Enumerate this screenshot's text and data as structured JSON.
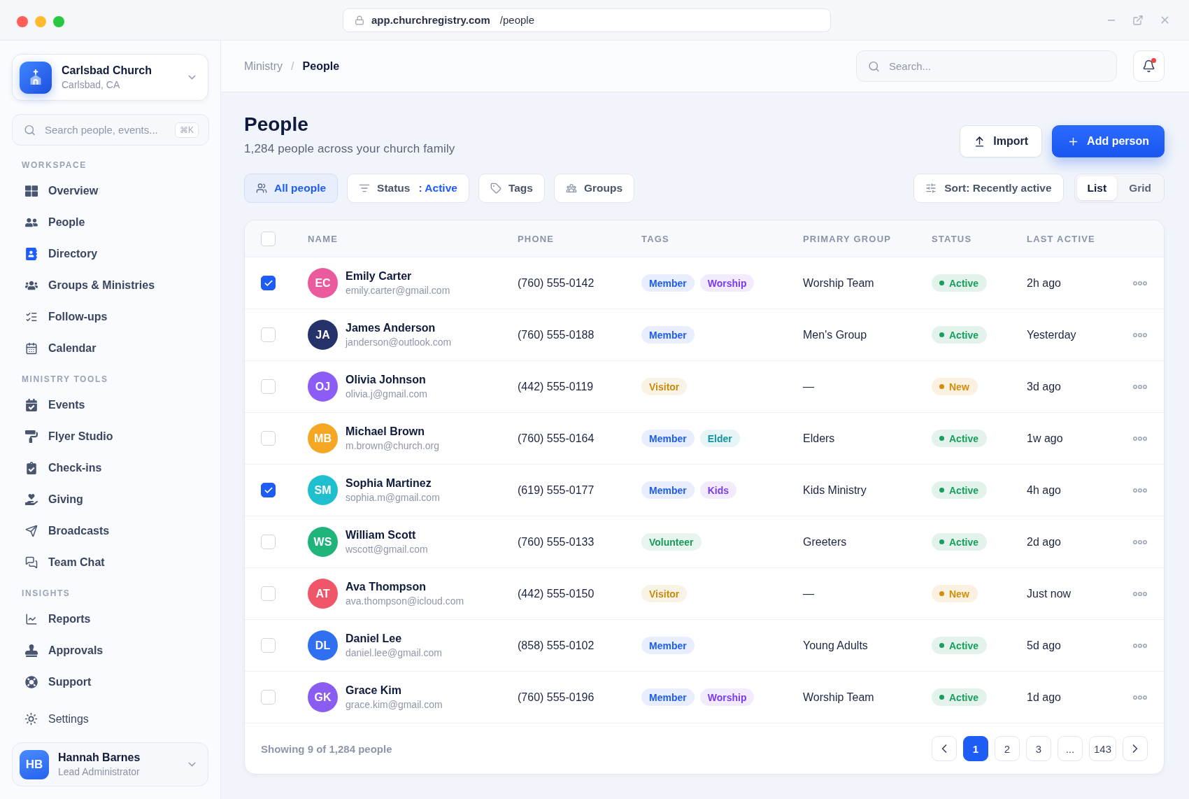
{
  "window": {
    "url_host": "app.churchregistry.com",
    "url_path": "/people"
  },
  "sidebar": {
    "church": {
      "name": "Carlsbad Church",
      "location": "Carlsbad, CA"
    },
    "search": {
      "placeholder": "Search people, events...",
      "shortcut": "⌘K"
    },
    "sections": [
      {
        "title": "WORKSPACE",
        "items": [
          {
            "label": "Overview"
          },
          {
            "label": "People"
          },
          {
            "label": "Directory"
          },
          {
            "label": "Groups & Ministries"
          },
          {
            "label": "Follow-ups"
          },
          {
            "label": "Calendar"
          }
        ]
      },
      {
        "title": "MINISTRY TOOLS",
        "items": [
          {
            "label": "Events"
          },
          {
            "label": "Flyer Studio"
          },
          {
            "label": "Check-ins"
          },
          {
            "label": "Giving"
          },
          {
            "label": "Broadcasts"
          },
          {
            "label": "Team Chat"
          }
        ]
      },
      {
        "title": "INSIGHTS",
        "items": [
          {
            "label": "Reports"
          },
          {
            "label": "Approvals"
          },
          {
            "label": "Support"
          }
        ]
      }
    ],
    "settings": {
      "label": "Settings"
    },
    "user": {
      "initials": "HB",
      "name": "Hannah Barnes",
      "role": "Lead Administrator"
    }
  },
  "header": {
    "breadcrumb": [
      "Ministry",
      "People"
    ],
    "breadcrumb_separator": "/",
    "search": {
      "placeholder": "Search..."
    },
    "notifications_unread": true
  },
  "page": {
    "title": "People",
    "subtitle": "1,284 people across your church family",
    "buttons": [
      {
        "label": "Import",
        "kind": "secondary"
      },
      {
        "label": "Add person",
        "kind": "primary"
      }
    ]
  },
  "filters": [
    {
      "label": "All people",
      "selected": true
    },
    {
      "label": "Status",
      "value": ": Active",
      "selected": false
    },
    {
      "label": "Tags",
      "selected": false
    },
    {
      "label": "Groups",
      "selected": false
    }
  ],
  "sort": {
    "label": "Sort: Recently active"
  },
  "view_toggle": [
    {
      "label": "List",
      "selected": true
    },
    {
      "label": "Grid",
      "selected": false
    }
  ],
  "table": {
    "select_all": {
      "checked": false
    },
    "columns": [
      "NAME",
      "PHONE",
      "TAGS",
      "PRIMARY GROUP",
      "STATUS",
      "LAST ACTIVE"
    ],
    "rows": [
      {
        "selected": true,
        "initials": "EC",
        "color": "#ec5a9e",
        "name": "Emily Carter",
        "email": "emily.carter@gmail.com",
        "phone": "(760) 555-0142",
        "tags": [
          {
            "label": "Member",
            "color": "#1d5cf5"
          },
          {
            "label": "Worship",
            "color": "#7c3aed"
          }
        ],
        "primary_group": "Worship Team",
        "status": {
          "label": "Active",
          "color": "#17a05d"
        },
        "last_active": "2h ago"
      },
      {
        "selected": false,
        "initials": "JA",
        "color": "#26336b",
        "name": "James Anderson",
        "email": "janderson@outlook.com",
        "phone": "(760) 555-0188",
        "tags": [
          {
            "label": "Member",
            "color": "#1d5cf5"
          }
        ],
        "primary_group": "Men's Group",
        "status": {
          "label": "Active",
          "color": "#17a05d"
        },
        "last_active": "Yesterday"
      },
      {
        "selected": false,
        "initials": "OJ",
        "color": "#8b5cf6",
        "name": "Olivia Johnson",
        "email": "olivia.j@gmail.com",
        "phone": "(442) 555-0119",
        "tags": [
          {
            "label": "Visitor",
            "color": "#c88a0c"
          }
        ],
        "primary_group": "—",
        "status": {
          "label": "New",
          "color": "#d28e0a"
        },
        "last_active": "3d ago"
      },
      {
        "selected": false,
        "initials": "MB",
        "color": "#f5a623",
        "name": "Michael Brown",
        "email": "m.brown@church.org",
        "phone": "(760) 555-0164",
        "tags": [
          {
            "label": "Member",
            "color": "#1d5cf5"
          },
          {
            "label": "Elder",
            "color": "#0e95a0"
          }
        ],
        "primary_group": "Elders",
        "status": {
          "label": "Active",
          "color": "#17a05d"
        },
        "last_active": "1w ago"
      },
      {
        "selected": true,
        "initials": "SM",
        "color": "#1fbfcf",
        "name": "Sophia Martinez",
        "email": "sophia.m@gmail.com",
        "phone": "(619) 555-0177",
        "tags": [
          {
            "label": "Member",
            "color": "#1d5cf5"
          },
          {
            "label": "Kids",
            "color": "#7c3aed"
          }
        ],
        "primary_group": "Kids Ministry",
        "status": {
          "label": "Active",
          "color": "#17a05d"
        },
        "last_active": "4h ago"
      },
      {
        "selected": false,
        "initials": "WS",
        "color": "#1fb57a",
        "name": "William Scott",
        "email": "wscott@gmail.com",
        "phone": "(760) 555-0133",
        "tags": [
          {
            "label": "Volunteer",
            "color": "#179a5a"
          }
        ],
        "primary_group": "Greeters",
        "status": {
          "label": "Active",
          "color": "#17a05d"
        },
        "last_active": "2d ago"
      },
      {
        "selected": false,
        "initials": "AT",
        "color": "#f0566a",
        "name": "Ava Thompson",
        "email": "ava.thompson@icloud.com",
        "phone": "(442) 555-0150",
        "tags": [
          {
            "label": "Visitor",
            "color": "#c88a0c"
          }
        ],
        "primary_group": "—",
        "status": {
          "label": "New",
          "color": "#d28e0a"
        },
        "last_active": "Just now"
      },
      {
        "selected": false,
        "initials": "DL",
        "color": "#2f6ff0",
        "name": "Daniel Lee",
        "email": "daniel.lee@gmail.com",
        "phone": "(858) 555-0102",
        "tags": [
          {
            "label": "Member",
            "color": "#1d5cf5"
          }
        ],
        "primary_group": "Young Adults",
        "status": {
          "label": "Active",
          "color": "#17a05d"
        },
        "last_active": "5d ago"
      },
      {
        "selected": false,
        "initials": "GK",
        "color": "#8a5cf0",
        "name": "Grace Kim",
        "email": "grace.kim@gmail.com",
        "phone": "(760) 555-0196",
        "tags": [
          {
            "label": "Member",
            "color": "#1d5cf5"
          },
          {
            "label": "Worship",
            "color": "#7c3aed"
          }
        ],
        "primary_group": "Worship Team",
        "status": {
          "label": "Active",
          "color": "#17a05d"
        },
        "last_active": "1d ago"
      }
    ]
  },
  "footer": {
    "summary": "Showing 9 of 1,284 people",
    "pages": [
      {
        "label": "1",
        "selected": true
      },
      {
        "label": "2",
        "selected": false
      },
      {
        "label": "3",
        "selected": false
      },
      {
        "label": "...",
        "selected": false
      },
      {
        "label": "143",
        "selected": false
      }
    ]
  }
}
